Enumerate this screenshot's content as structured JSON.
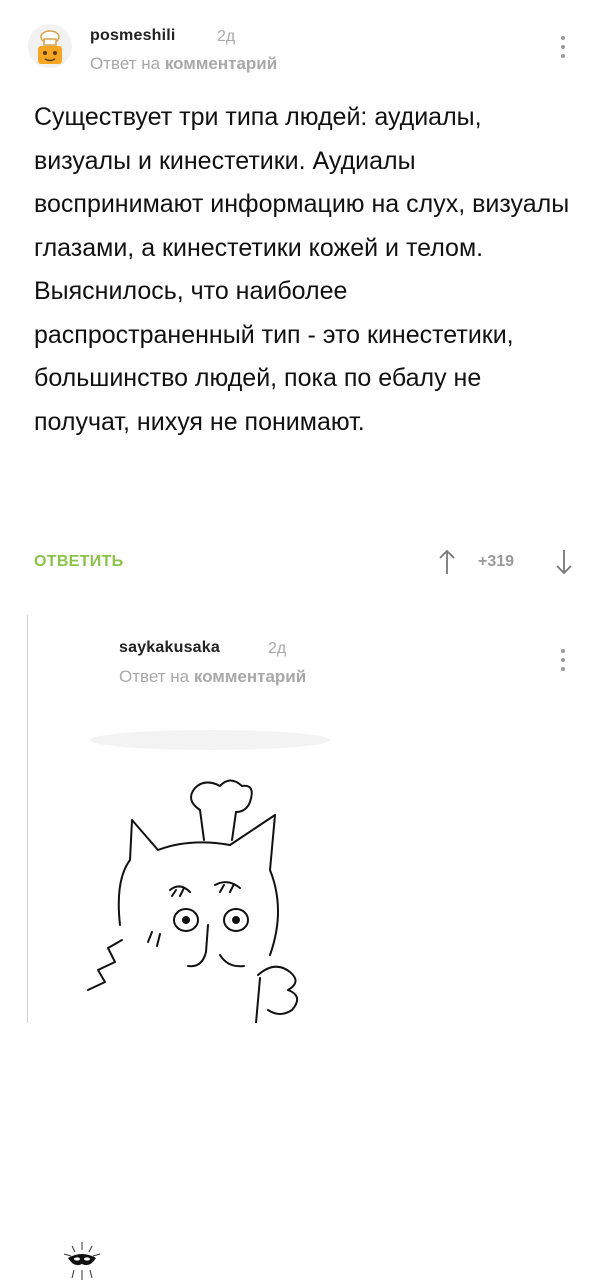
{
  "comments": [
    {
      "author": "posmeshili",
      "age": "2д",
      "reply_prefix": "Ответ на",
      "reply_target": "комментарий",
      "avatar_icon": "chef-avatar-icon",
      "paragraphs": [
        "Существует три типа людей: аудиалы, визуалы и кинестетики. Аудиалы воспринимают информацию на слух, визуалы глазами, а кинестетики кожей и телом.",
        "Выяснилось, что наиболее распространенный тип - это кинестетики, большинство людей, пока по ебалу не получат, нихуя не понимают."
      ],
      "reply_label": "ОТВЕТИТЬ",
      "rating": "+319"
    },
    {
      "author": "saykakusaka",
      "age": "2д",
      "reply_prefix": "Ответ на",
      "reply_target": "комментарий",
      "avatar_icon": "mask-avatar-icon",
      "attachment_icon": "cat-chef-drawing"
    }
  ],
  "colors": {
    "accent_green": "#8bc34a",
    "muted_gray": "#a8a8a8",
    "text": "#111111",
    "thread_line": "#d0d0d0"
  }
}
